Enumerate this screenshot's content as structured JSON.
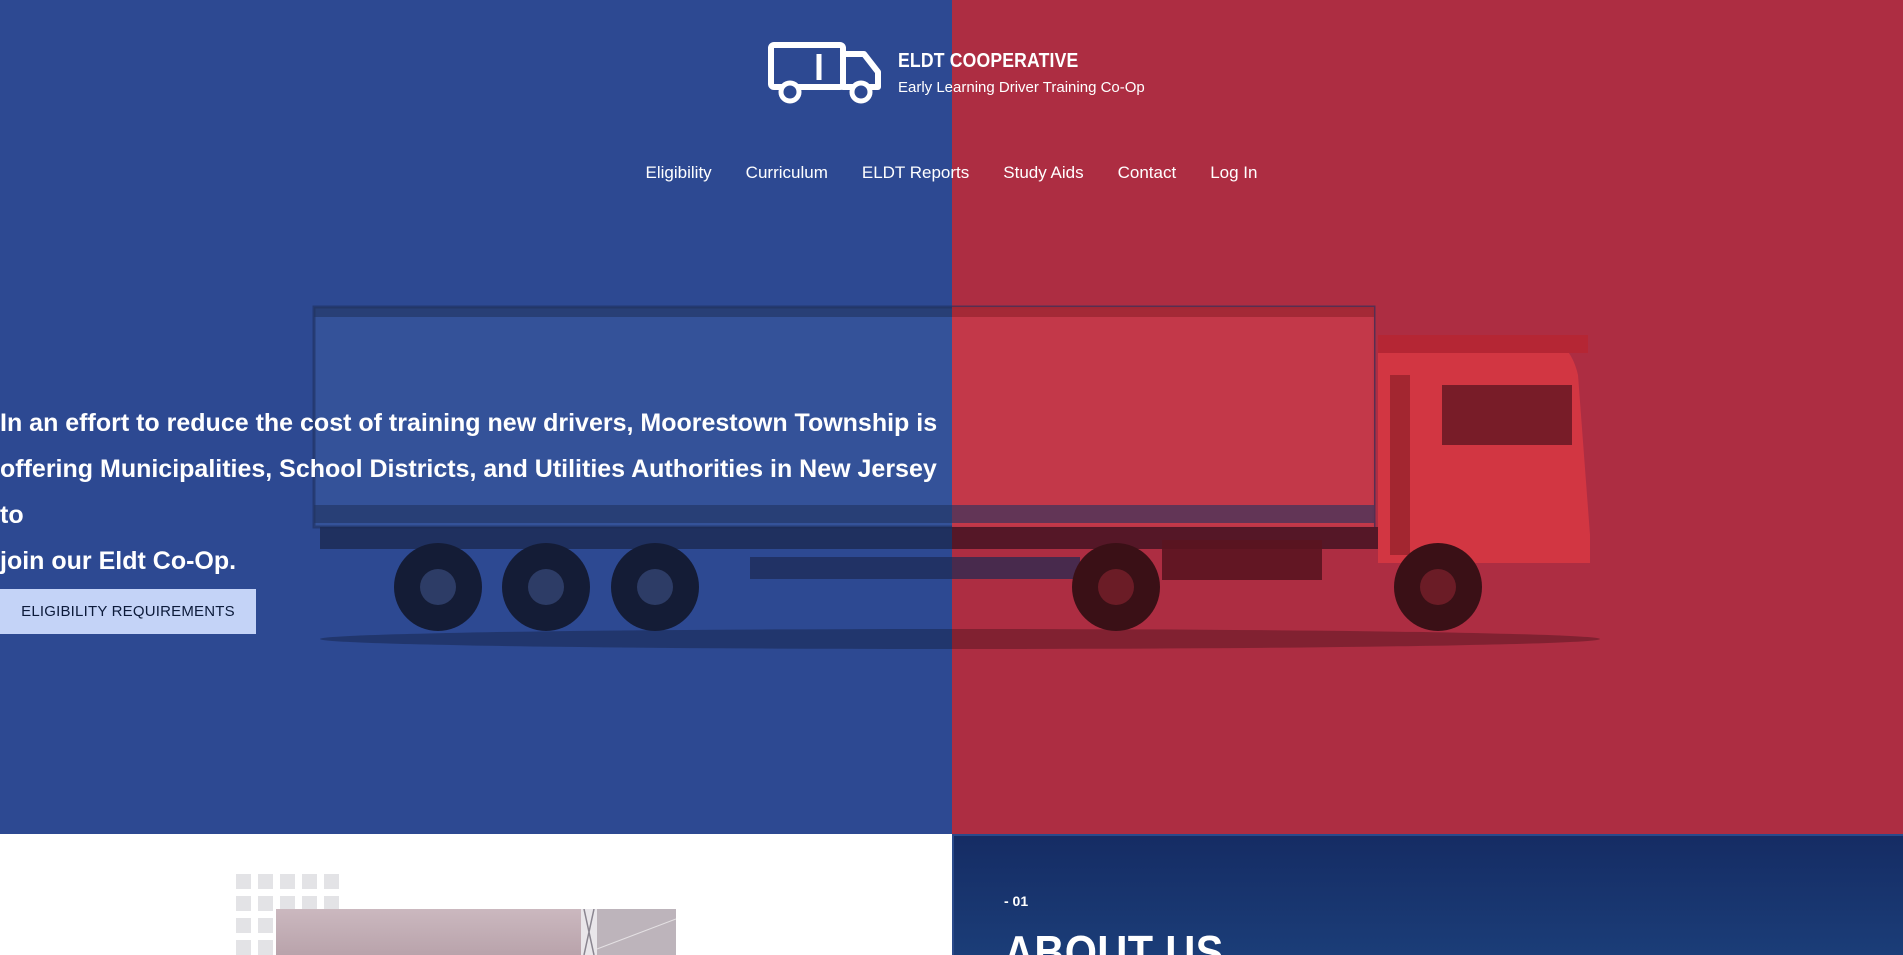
{
  "brand": {
    "title": "ELDT COOPERATIVE",
    "subtitle": "Early Learning Driver Training Co-Op",
    "logo_icon": "truck-icon"
  },
  "nav": {
    "items": [
      {
        "label": "Eligibility"
      },
      {
        "label": "Curriculum"
      },
      {
        "label": "ELDT Reports"
      },
      {
        "label": "Study Aids"
      },
      {
        "label": "Contact"
      },
      {
        "label": "Log In"
      }
    ]
  },
  "hero": {
    "lines": [
      "In an effort to reduce the cost of training new drivers, Moorestown Township is",
      "offering Municipalities, School Districts, and Utilities Authorities in New Jersey to",
      "join our Eldt Co-Op."
    ],
    "cta_label": "ELIGIBILITY REQUIREMENTS"
  },
  "about": {
    "number": "- 01",
    "title": "ABOUT US"
  },
  "colors": {
    "hero_left": "#2d4992",
    "hero_right": "#ad2d42",
    "cta_bg": "#c4d3f7",
    "about_bg": "#152c64"
  }
}
